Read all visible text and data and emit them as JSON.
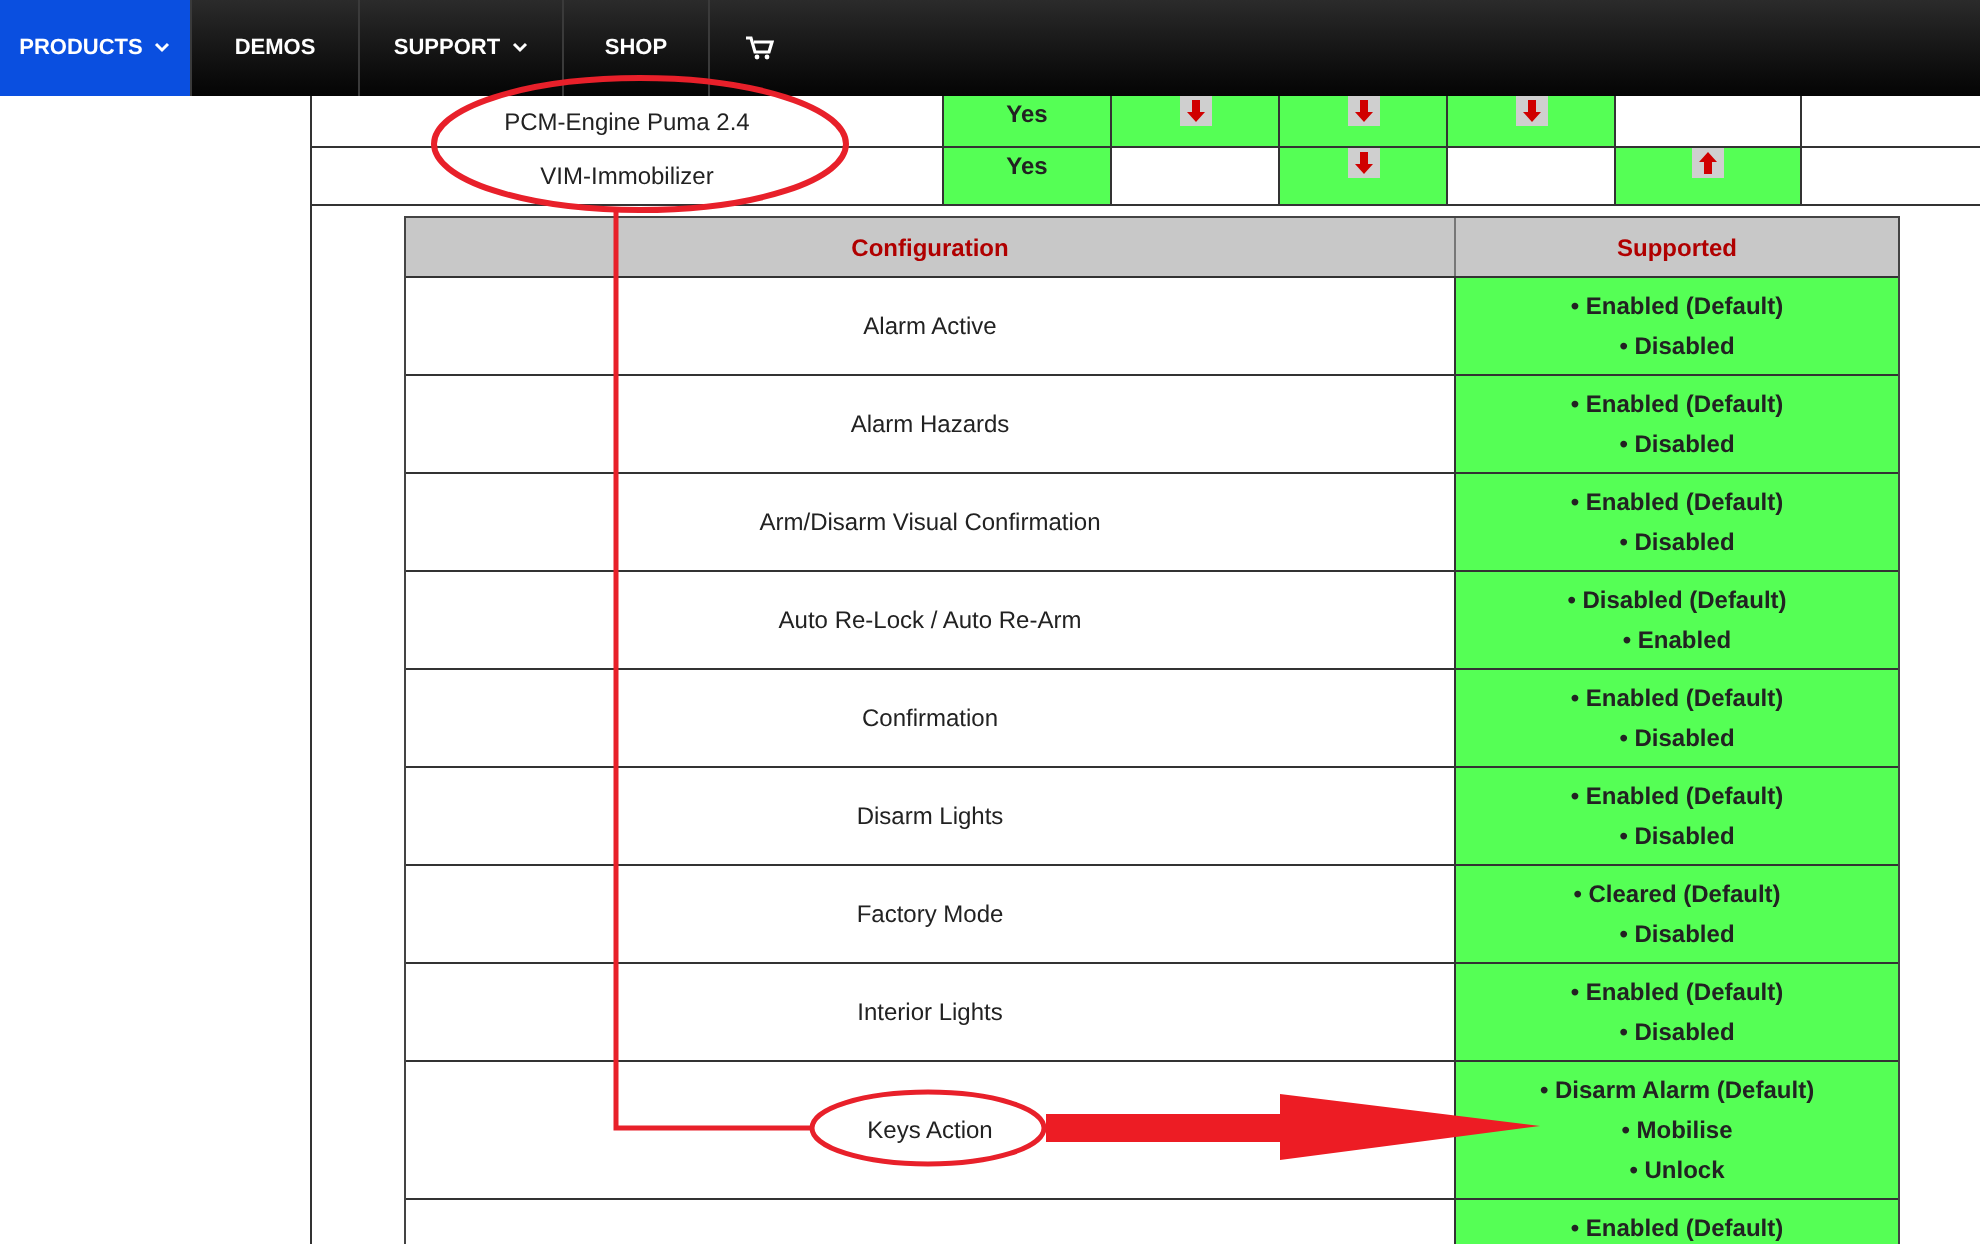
{
  "nav": {
    "items": [
      {
        "label": "PRODUCTS",
        "dropdown": true,
        "selected": true
      },
      {
        "label": "DEMOS",
        "dropdown": false,
        "selected": false
      },
      {
        "label": "SUPPORT",
        "dropdown": true,
        "selected": false
      },
      {
        "label": "SHOP",
        "dropdown": false,
        "selected": false
      }
    ]
  },
  "compat_rows": [
    {
      "name": "PCM-Engine Puma 2.4",
      "cells": [
        {
          "kind": "text",
          "text": "Yes",
          "highlighted": true
        },
        {
          "kind": "down",
          "highlighted": true
        },
        {
          "kind": "down",
          "highlighted": true
        },
        {
          "kind": "down",
          "highlighted": true
        },
        {
          "kind": "empty",
          "highlighted": false
        },
        {
          "kind": "empty",
          "highlighted": false
        }
      ]
    },
    {
      "name": "VIM-Immobilizer",
      "cells": [
        {
          "kind": "text",
          "text": "Yes",
          "highlighted": true
        },
        {
          "kind": "empty",
          "highlighted": false
        },
        {
          "kind": "down",
          "highlighted": true
        },
        {
          "kind": "empty",
          "highlighted": false
        },
        {
          "kind": "up",
          "highlighted": true
        },
        {
          "kind": "empty",
          "highlighted": false
        }
      ]
    }
  ],
  "config_table": {
    "columns": [
      "Configuration",
      "Supported"
    ],
    "rows": [
      {
        "name": "Alarm Active",
        "options": [
          "• Enabled (Default)",
          "• Disabled"
        ]
      },
      {
        "name": "Alarm Hazards",
        "options": [
          "• Enabled (Default)",
          "• Disabled"
        ]
      },
      {
        "name": "Arm/Disarm Visual Confirmation",
        "options": [
          "• Enabled (Default)",
          "• Disabled"
        ]
      },
      {
        "name": "Auto Re-Lock / Auto Re-Arm",
        "options": [
          "• Disabled (Default)",
          "• Enabled"
        ]
      },
      {
        "name": "Confirmation",
        "options": [
          "• Enabled (Default)",
          "• Disabled"
        ]
      },
      {
        "name": "Disarm Lights",
        "options": [
          "• Enabled (Default)",
          "• Disabled"
        ]
      },
      {
        "name": "Factory Mode",
        "options": [
          "• Cleared (Default)",
          "• Disabled"
        ]
      },
      {
        "name": "Interior Lights",
        "options": [
          "• Enabled (Default)",
          "• Disabled"
        ]
      },
      {
        "name": "Keys Action",
        "options": [
          "• Disarm Alarm (Default)",
          "• Mobilise",
          "• Unlock"
        ]
      },
      {
        "options": [
          "• Enabled (Default)"
        ]
      }
    ]
  }
}
